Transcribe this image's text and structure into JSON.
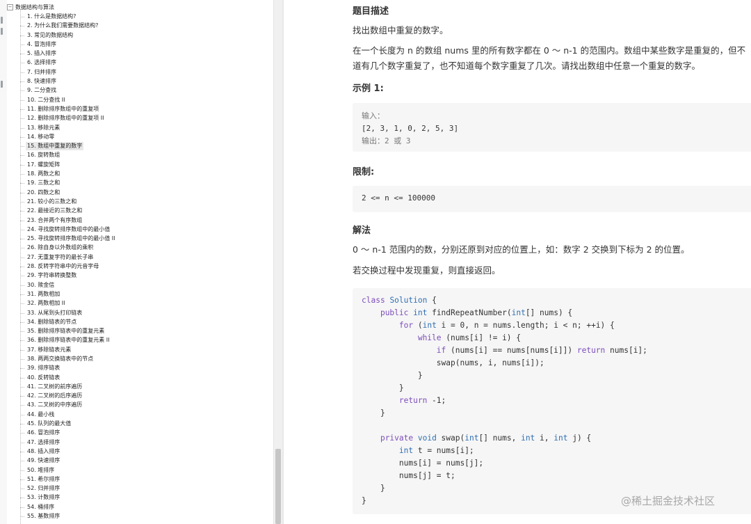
{
  "sidebar": {
    "root_label": "数据结构与算法",
    "toggle_symbol": "−",
    "selected_index": 14,
    "items": [
      "1. 什么是数据结构?",
      "2. 为什么我们需要数据结构?",
      "3. 常见的数据结构",
      "4. 冒泡排序",
      "5. 插入排序",
      "6. 选择排序",
      "7. 归并排序",
      "8. 快速排序",
      "9. 二分查找",
      "10. 二分查找 II",
      "11. 删除排序数组中的重复项",
      "12. 删除排序数组中的重复项 II",
      "13. 移除元素",
      "14. 移动零",
      "15. 数组中重复的数字",
      "16. 旋转数组",
      "17. 螺旋矩阵",
      "18. 两数之和",
      "19. 三数之和",
      "20. 四数之和",
      "21. 较小的三数之和",
      "22. 最接近的三数之和",
      "23. 合并两个有序数组",
      "24. 寻找旋转排序数组中的最小值",
      "25. 寻找旋转排序数组中的最小值 II",
      "26. 除自身以外数组的乘积",
      "27. 无重复字符的最长子串",
      "28. 反转字符串中的元音字母",
      "29. 字符串转换整数",
      "30. 赎金信",
      "31. 两数相加",
      "32. 两数相加 II",
      "33. 从尾到头打印链表",
      "34. 删除链表的节点",
      "35. 删除排序链表中的重复元素",
      "36. 删除排序链表中的重复元素 II",
      "37. 移除链表元素",
      "38. 两两交换链表中的节点",
      "39. 排序链表",
      "40. 反转链表",
      "41. 二叉树的前序遍历",
      "42. 二叉树的后序遍历",
      "43. 二叉树的中序遍历",
      "44. 最小栈",
      "45. 队列的最大值",
      "46. 冒泡排序",
      "47. 选择排序",
      "48. 插入排序",
      "49. 快速排序",
      "50. 堆排序",
      "51. 希尔排序",
      "52. 归并排序",
      "53. 计数排序",
      "54. 桶排序",
      "55. 基数排序"
    ]
  },
  "article": {
    "section_description": "题目描述",
    "description_1": "找出数组中重复的数字。",
    "description_2_line1": "在一个长度为 n 的数组 nums 里的所有数字都在 0 ～ n-1 的范围内。数组中某些数字是重复的，但不",
    "description_2_line2": "道有几个数字重复了，也不知道每个数字重复了几次。请找出数组中任意一个重复的数字。",
    "section_example": "示例 1:",
    "example_input_label": "输入：",
    "example_input_value": "[2, 3, 1, 0, 2, 5, 3]",
    "example_output": "输出：2 或 3",
    "section_limit": "限制:",
    "limit_text": "2 <= n <= 100000",
    "section_solution": "解法",
    "solution_1": "0 ～ n-1 范围内的数，分别还原到对应的位置上，如：数字 2 交换到下标为 2 的位置。",
    "solution_2": "若交换过程中发现重复，则直接返回。"
  },
  "code_lines": [
    [
      [
        "kw",
        "class"
      ],
      [
        "t",
        " "
      ],
      [
        "ty",
        "Solution"
      ],
      [
        "t",
        " {"
      ]
    ],
    [
      [
        "t",
        "    "
      ],
      [
        "kw",
        "public"
      ],
      [
        "t",
        " "
      ],
      [
        "ty",
        "int"
      ],
      [
        "t",
        " findRepeatNumber("
      ],
      [
        "ty",
        "int"
      ],
      [
        "t",
        "[] nums) {"
      ]
    ],
    [
      [
        "t",
        "        "
      ],
      [
        "kw",
        "for"
      ],
      [
        "t",
        " ("
      ],
      [
        "ty",
        "int"
      ],
      [
        "t",
        " i = 0, n = nums.length; i < n; ++i) {"
      ]
    ],
    [
      [
        "t",
        "            "
      ],
      [
        "kw",
        "while"
      ],
      [
        "t",
        " (nums[i] != i) {"
      ]
    ],
    [
      [
        "t",
        "                "
      ],
      [
        "kw",
        "if"
      ],
      [
        "t",
        " (nums[i] == nums[nums[i]]) "
      ],
      [
        "kw",
        "return"
      ],
      [
        "t",
        " nums[i];"
      ]
    ],
    [
      [
        "t",
        "                swap(nums, i, nums[i]);"
      ]
    ],
    [
      [
        "t",
        "            }"
      ]
    ],
    [
      [
        "t",
        "        }"
      ]
    ],
    [
      [
        "t",
        "        "
      ],
      [
        "kw",
        "return"
      ],
      [
        "t",
        " -1;"
      ]
    ],
    [
      [
        "t",
        "    }"
      ]
    ],
    [
      [
        "t",
        ""
      ]
    ],
    [
      [
        "t",
        "    "
      ],
      [
        "kw",
        "private"
      ],
      [
        "t",
        " "
      ],
      [
        "ty",
        "void"
      ],
      [
        "t",
        " swap("
      ],
      [
        "ty",
        "int"
      ],
      [
        "t",
        "[] nums, "
      ],
      [
        "ty",
        "int"
      ],
      [
        "t",
        " i, "
      ],
      [
        "ty",
        "int"
      ],
      [
        "t",
        " j) {"
      ]
    ],
    [
      [
        "t",
        "        "
      ],
      [
        "ty",
        "int"
      ],
      [
        "t",
        " t = nums[i];"
      ]
    ],
    [
      [
        "t",
        "        nums[i] = nums[j];"
      ]
    ],
    [
      [
        "t",
        "        nums[j] = t;"
      ]
    ],
    [
      [
        "t",
        "    }"
      ]
    ],
    [
      [
        "t",
        "}"
      ]
    ]
  ],
  "watermark": "@稀土掘金技术社区"
}
